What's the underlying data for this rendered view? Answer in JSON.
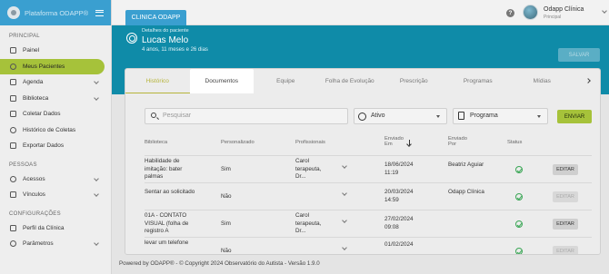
{
  "app": {
    "brand": "Plataforma ODAPP®"
  },
  "sidebar": {
    "sections": [
      {
        "label": "PRINCIPAL"
      },
      {
        "label": "PESSOAS"
      },
      {
        "label": "CONFIGURAÇÕES"
      }
    ],
    "items": [
      {
        "label": "Painel",
        "icon": "grid-icon"
      },
      {
        "label": "Meus Pacientes",
        "icon": "eye-icon",
        "active": true
      },
      {
        "label": "Agenda",
        "icon": "calendar-icon"
      },
      {
        "label": "Biblioteca",
        "icon": "book-icon"
      },
      {
        "label": "Coletar Dados",
        "icon": "pencil-icon"
      },
      {
        "label": "Histórico de Coletas",
        "icon": "history-icon"
      },
      {
        "label": "Exportar Dados",
        "icon": "export-icon"
      },
      {
        "label": "Acessos",
        "icon": "key-icon"
      },
      {
        "label": "Vínculos",
        "icon": "link-icon"
      },
      {
        "label": "Perfil da Clínica",
        "icon": "building-icon"
      },
      {
        "label": "Parâmetros",
        "icon": "gear-icon"
      }
    ]
  },
  "topbar": {
    "clinic_tab": "CLINICA ODAPP",
    "help": "?",
    "user_name": "Odapp Clínica",
    "user_role": "Principal"
  },
  "patient": {
    "label": "Detalhes do paciente",
    "name": "Lucas Melo",
    "age": "4 anos, 11 meses e 26 dias",
    "save_label": "SALVAR"
  },
  "tabs": [
    {
      "label": "Histórico"
    },
    {
      "label": "Documentos"
    },
    {
      "label": "Equipe"
    },
    {
      "label": "Folha de Evolução"
    },
    {
      "label": "Prescrição"
    },
    {
      "label": "Programas"
    },
    {
      "label": "Mídias"
    }
  ],
  "filters": {
    "search_placeholder": "Pesquisar",
    "status_value": "Ativo",
    "type_value": "Programa",
    "send_label": "ENVIAR"
  },
  "table": {
    "headers": {
      "library": "Biblioteca",
      "custom": "Personalizado",
      "pros": "Profissionais",
      "sent_at": "Enviado Em",
      "sent_by": "Enviado Por",
      "status": "Status"
    },
    "rows": [
      {
        "library": "Habilidade de imitação: bater palmas",
        "custom": "Sim",
        "pros": "Carol terapeuta, Dr...",
        "date": "18/06/2024",
        "time": "11:19",
        "by": "Beatriz Aguiar",
        "edit": "EDITAR",
        "enabled": true
      },
      {
        "library": "Sentar ao solicitado",
        "custom": "Não",
        "pros": "",
        "date": "20/03/2024",
        "time": "14:59",
        "by": "Odapp Clínica",
        "edit": "EDITAR",
        "enabled": false
      },
      {
        "library": "01A - CONTATO VISUAL (folha de registro A",
        "custom": "Sim",
        "pros": "Carol terapeuta, Dr...",
        "date": "27/02/2024",
        "time": "09:08",
        "by": "",
        "edit": "EDITAR",
        "enabled": true
      },
      {
        "library": "levar um telefone",
        "custom": "Não",
        "pros": "",
        "date": "01/02/2024",
        "time": "",
        "by": "",
        "edit": "EDITAR",
        "enabled": false
      }
    ]
  },
  "footer": "Powered by ODAPP® - © Copyright 2024 Observatório do Autista - Versão 1.9.0"
}
